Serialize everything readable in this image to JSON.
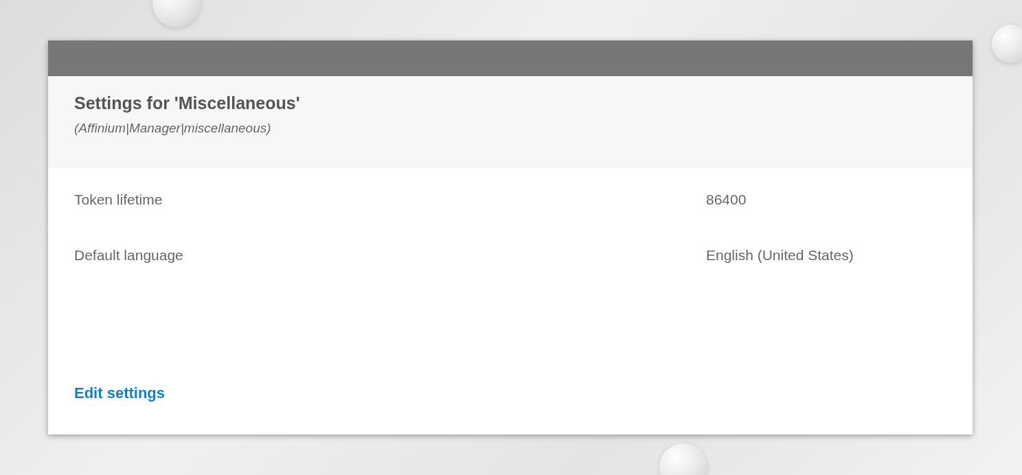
{
  "panel": {
    "title": "Settings for 'Miscellaneous'",
    "subtitle": "(Affinium|Manager|miscellaneous)"
  },
  "settings": [
    {
      "label": "Token lifetime",
      "value": "86400"
    },
    {
      "label": "Default language",
      "value": "English (United States)"
    }
  ],
  "link": "Edit settings"
}
